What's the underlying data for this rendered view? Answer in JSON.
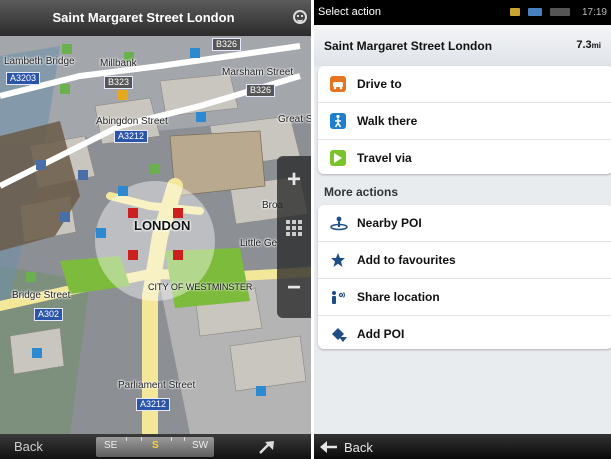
{
  "map": {
    "title": "Saint Margaret Street  London",
    "city_label": "LONDON",
    "district_label": "CITY OF WESTMINSTER",
    "streets": [
      "Lambeth Bridge",
      "Millbank",
      "Marsham Street",
      "Abingdon Street",
      "Great S",
      "Bridge Street",
      "Parliament Street",
      "Little Ge",
      "Broa"
    ],
    "road_shields": [
      "A3203",
      "B326",
      "B323",
      "B326",
      "A3212",
      "A302",
      "A3212"
    ],
    "zoom_in_label": "+",
    "zoom_out_label": "−",
    "bottom": {
      "back_label": "Back",
      "compass": [
        "SE",
        "S",
        "SW"
      ]
    }
  },
  "action": {
    "status_title": "Select action",
    "status_time": "17:19",
    "location_name": "Saint Margaret Street  London",
    "distance": "7.3",
    "distance_unit": "mi",
    "primary_actions": [
      {
        "label": "Drive to",
        "icon": "car-icon"
      },
      {
        "label": "Walk there",
        "icon": "pedestrian-icon"
      },
      {
        "label": "Travel via",
        "icon": "waypoint-icon"
      }
    ],
    "more_title": "More actions",
    "more_actions": [
      {
        "label": "Nearby POI",
        "icon": "nearby-poi-icon"
      },
      {
        "label": "Add to favourites",
        "icon": "star-icon"
      },
      {
        "label": "Share location",
        "icon": "share-location-icon"
      },
      {
        "label": "Add POI",
        "icon": "add-poi-icon"
      }
    ],
    "back_label": "Back"
  },
  "colors": {
    "drive_icon": "#e8731e",
    "walk_icon": "#1e7fd0",
    "travel_icon": "#7cc32b",
    "road_shield": "#2b55a8",
    "park_green": "#7dbb3c",
    "route_yellow": "#f3e79a"
  }
}
